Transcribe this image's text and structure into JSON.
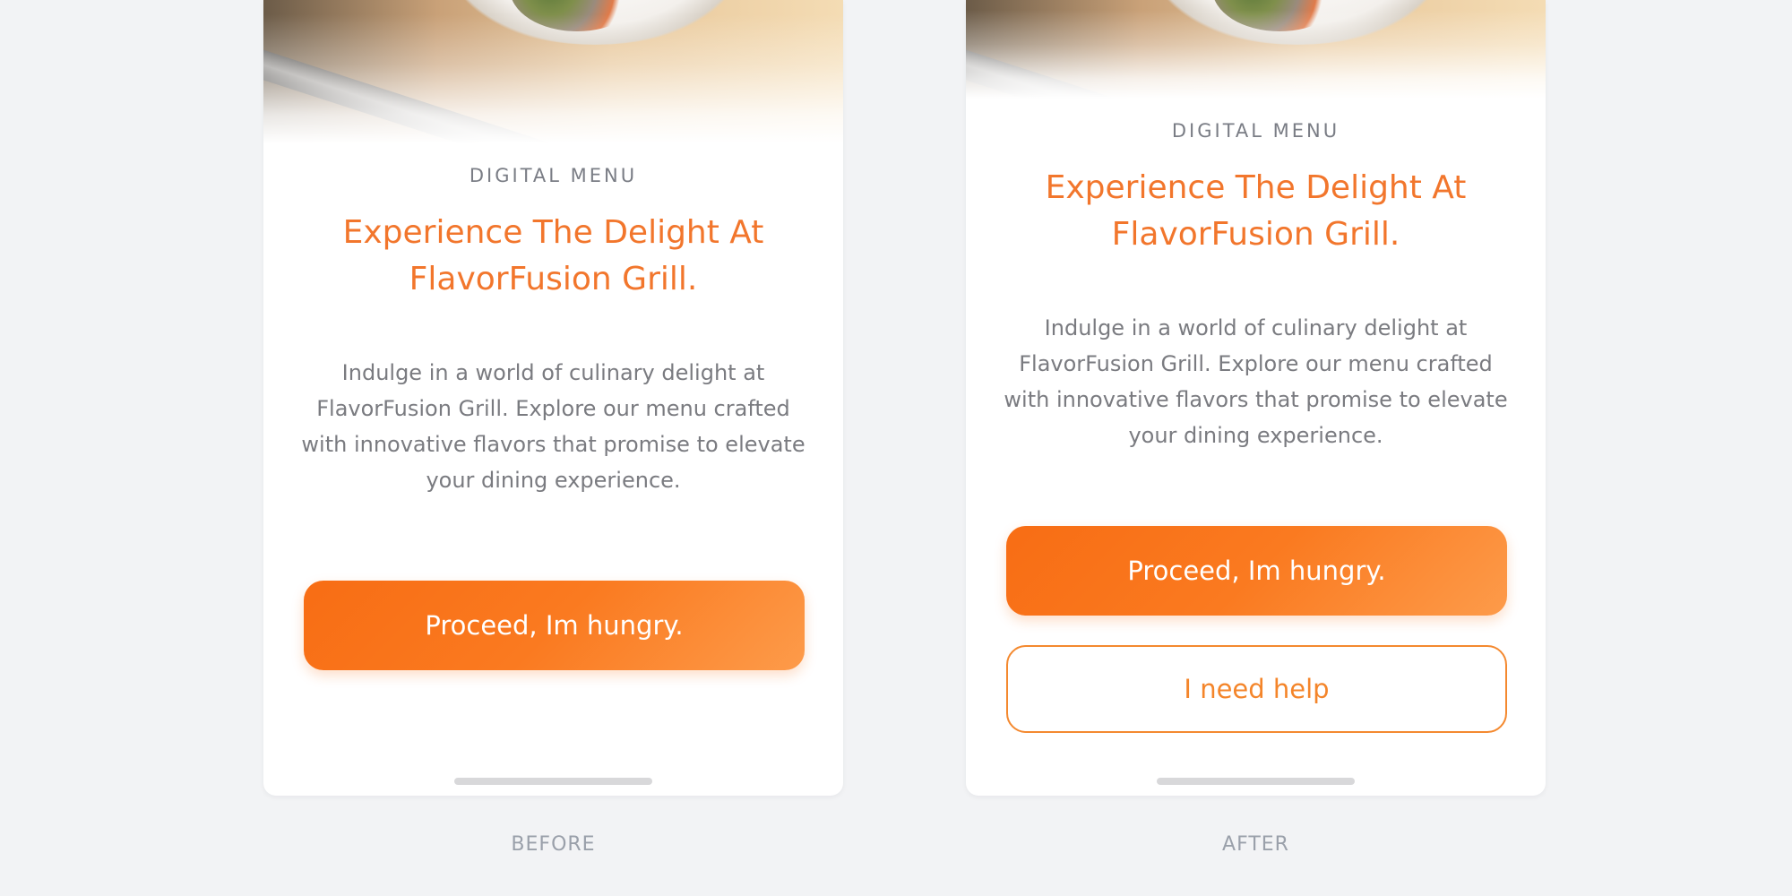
{
  "before": {
    "eyebrow": "DIGITAL MENU",
    "headline": "Experience The Delight At FlavorFusion Grill.",
    "body": "Indulge in a world of culinary delight at FlavorFusion Grill. Explore our menu crafted with innovative flavors that promise to elevate your dining experience.",
    "primary_button": "Proceed, Im hungry.",
    "caption": "BEFORE"
  },
  "after": {
    "eyebrow": "DIGITAL MENU",
    "headline": "Experience The Delight At FlavorFusion Grill.",
    "body": "Indulge in a world of culinary delight at FlavorFusion Grill. Explore our menu crafted with innovative flavors that promise to elevate your dining experience.",
    "primary_button": "Proceed, Im hungry.",
    "secondary_button": "I need help",
    "caption": "AFTER"
  },
  "colors": {
    "accent": "#f2762c",
    "button_gradient_start": "#f86d14",
    "button_gradient_end": "#fd9b4a",
    "body_text": "#7a7b80",
    "background": "#f2f3f5"
  }
}
